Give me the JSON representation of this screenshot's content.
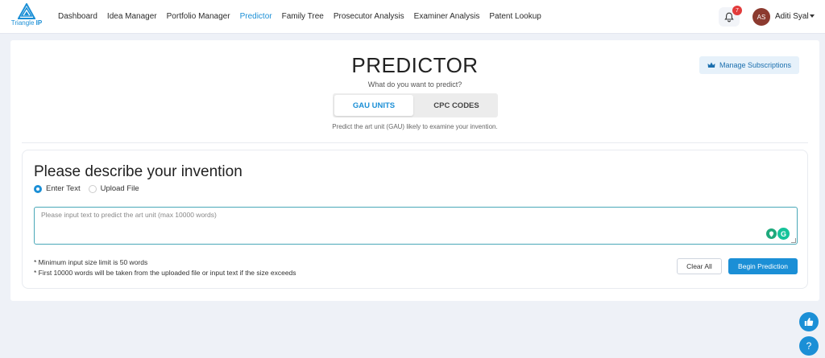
{
  "brand": {
    "logo_text_main": "Triangle ",
    "logo_text_accent": "IP",
    "color": "#1b8fd6"
  },
  "nav": {
    "items": [
      {
        "label": "Dashboard"
      },
      {
        "label": "Idea Manager"
      },
      {
        "label": "Portfolio Manager"
      },
      {
        "label": "Predictor",
        "active": true
      },
      {
        "label": "Family Tree"
      },
      {
        "label": "Prosecutor Analysis"
      },
      {
        "label": "Examiner Analysis"
      },
      {
        "label": "Patent Lookup"
      }
    ]
  },
  "header": {
    "notification_icon": "bell-icon",
    "notification_count": "7",
    "user_initials": "AS",
    "user_name": "Aditi Syal",
    "user_menu_icon": "caret-down-icon"
  },
  "page": {
    "title": "PREDICTOR",
    "subtitle": "What do you want to predict?",
    "manage_button": {
      "icon": "crown-icon",
      "label": "Manage Subscriptions"
    },
    "tabs": [
      {
        "label": "GAU UNITS",
        "selected": true
      },
      {
        "label": "CPC CODES",
        "selected": false
      }
    ],
    "hint": "Predict the art unit (GAU) likely to examine your invention."
  },
  "form": {
    "heading": "Please describe your invention",
    "options": [
      {
        "label": "Enter Text",
        "selected": true
      },
      {
        "label": "Upload File",
        "selected": false
      }
    ],
    "placeholder": "Please input text to predict the art unit (max 10000 words)",
    "value": "",
    "notes": [
      "* Minimum input size limit is 50 words",
      "* First 10000 words will be taken from the uploaded file or input text if the size exceeds"
    ],
    "clear_label": "Clear All",
    "submit_label": "Begin Prediction"
  },
  "floating": {
    "feedback_icon": "thumbs-up-icon",
    "help_icon": "question-icon",
    "help_glyph": "?"
  },
  "colors": {
    "accent": "#1b8fd6",
    "badge": "#e23b3b",
    "avatar": "#8c3a2f",
    "background": "#eef1f7"
  }
}
